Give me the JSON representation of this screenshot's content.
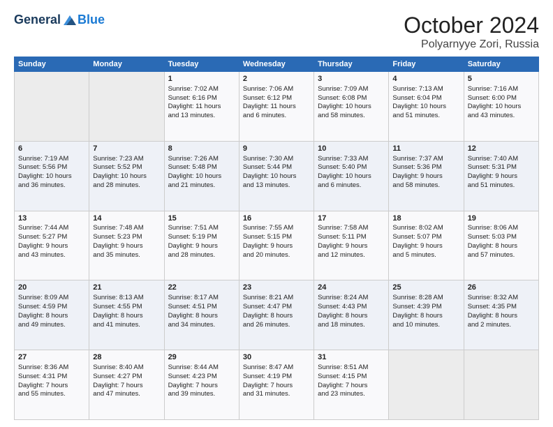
{
  "header": {
    "logo_general": "General",
    "logo_blue": "Blue",
    "title": "October 2024",
    "subtitle": "Polyarnyye Zori, Russia"
  },
  "weekdays": [
    "Sunday",
    "Monday",
    "Tuesday",
    "Wednesday",
    "Thursday",
    "Friday",
    "Saturday"
  ],
  "weeks": [
    [
      {
        "day": "",
        "info": ""
      },
      {
        "day": "",
        "info": ""
      },
      {
        "day": "1",
        "info": "Sunrise: 7:02 AM\nSunset: 6:16 PM\nDaylight: 11 hours\nand 13 minutes."
      },
      {
        "day": "2",
        "info": "Sunrise: 7:06 AM\nSunset: 6:12 PM\nDaylight: 11 hours\nand 6 minutes."
      },
      {
        "day": "3",
        "info": "Sunrise: 7:09 AM\nSunset: 6:08 PM\nDaylight: 10 hours\nand 58 minutes."
      },
      {
        "day": "4",
        "info": "Sunrise: 7:13 AM\nSunset: 6:04 PM\nDaylight: 10 hours\nand 51 minutes."
      },
      {
        "day": "5",
        "info": "Sunrise: 7:16 AM\nSunset: 6:00 PM\nDaylight: 10 hours\nand 43 minutes."
      }
    ],
    [
      {
        "day": "6",
        "info": "Sunrise: 7:19 AM\nSunset: 5:56 PM\nDaylight: 10 hours\nand 36 minutes."
      },
      {
        "day": "7",
        "info": "Sunrise: 7:23 AM\nSunset: 5:52 PM\nDaylight: 10 hours\nand 28 minutes."
      },
      {
        "day": "8",
        "info": "Sunrise: 7:26 AM\nSunset: 5:48 PM\nDaylight: 10 hours\nand 21 minutes."
      },
      {
        "day": "9",
        "info": "Sunrise: 7:30 AM\nSunset: 5:44 PM\nDaylight: 10 hours\nand 13 minutes."
      },
      {
        "day": "10",
        "info": "Sunrise: 7:33 AM\nSunset: 5:40 PM\nDaylight: 10 hours\nand 6 minutes."
      },
      {
        "day": "11",
        "info": "Sunrise: 7:37 AM\nSunset: 5:36 PM\nDaylight: 9 hours\nand 58 minutes."
      },
      {
        "day": "12",
        "info": "Sunrise: 7:40 AM\nSunset: 5:31 PM\nDaylight: 9 hours\nand 51 minutes."
      }
    ],
    [
      {
        "day": "13",
        "info": "Sunrise: 7:44 AM\nSunset: 5:27 PM\nDaylight: 9 hours\nand 43 minutes."
      },
      {
        "day": "14",
        "info": "Sunrise: 7:48 AM\nSunset: 5:23 PM\nDaylight: 9 hours\nand 35 minutes."
      },
      {
        "day": "15",
        "info": "Sunrise: 7:51 AM\nSunset: 5:19 PM\nDaylight: 9 hours\nand 28 minutes."
      },
      {
        "day": "16",
        "info": "Sunrise: 7:55 AM\nSunset: 5:15 PM\nDaylight: 9 hours\nand 20 minutes."
      },
      {
        "day": "17",
        "info": "Sunrise: 7:58 AM\nSunset: 5:11 PM\nDaylight: 9 hours\nand 12 minutes."
      },
      {
        "day": "18",
        "info": "Sunrise: 8:02 AM\nSunset: 5:07 PM\nDaylight: 9 hours\nand 5 minutes."
      },
      {
        "day": "19",
        "info": "Sunrise: 8:06 AM\nSunset: 5:03 PM\nDaylight: 8 hours\nand 57 minutes."
      }
    ],
    [
      {
        "day": "20",
        "info": "Sunrise: 8:09 AM\nSunset: 4:59 PM\nDaylight: 8 hours\nand 49 minutes."
      },
      {
        "day": "21",
        "info": "Sunrise: 8:13 AM\nSunset: 4:55 PM\nDaylight: 8 hours\nand 41 minutes."
      },
      {
        "day": "22",
        "info": "Sunrise: 8:17 AM\nSunset: 4:51 PM\nDaylight: 8 hours\nand 34 minutes."
      },
      {
        "day": "23",
        "info": "Sunrise: 8:21 AM\nSunset: 4:47 PM\nDaylight: 8 hours\nand 26 minutes."
      },
      {
        "day": "24",
        "info": "Sunrise: 8:24 AM\nSunset: 4:43 PM\nDaylight: 8 hours\nand 18 minutes."
      },
      {
        "day": "25",
        "info": "Sunrise: 8:28 AM\nSunset: 4:39 PM\nDaylight: 8 hours\nand 10 minutes."
      },
      {
        "day": "26",
        "info": "Sunrise: 8:32 AM\nSunset: 4:35 PM\nDaylight: 8 hours\nand 2 minutes."
      }
    ],
    [
      {
        "day": "27",
        "info": "Sunrise: 8:36 AM\nSunset: 4:31 PM\nDaylight: 7 hours\nand 55 minutes."
      },
      {
        "day": "28",
        "info": "Sunrise: 8:40 AM\nSunset: 4:27 PM\nDaylight: 7 hours\nand 47 minutes."
      },
      {
        "day": "29",
        "info": "Sunrise: 8:44 AM\nSunset: 4:23 PM\nDaylight: 7 hours\nand 39 minutes."
      },
      {
        "day": "30",
        "info": "Sunrise: 8:47 AM\nSunset: 4:19 PM\nDaylight: 7 hours\nand 31 minutes."
      },
      {
        "day": "31",
        "info": "Sunrise: 8:51 AM\nSunset: 4:15 PM\nDaylight: 7 hours\nand 23 minutes."
      },
      {
        "day": "",
        "info": ""
      },
      {
        "day": "",
        "info": ""
      }
    ]
  ]
}
